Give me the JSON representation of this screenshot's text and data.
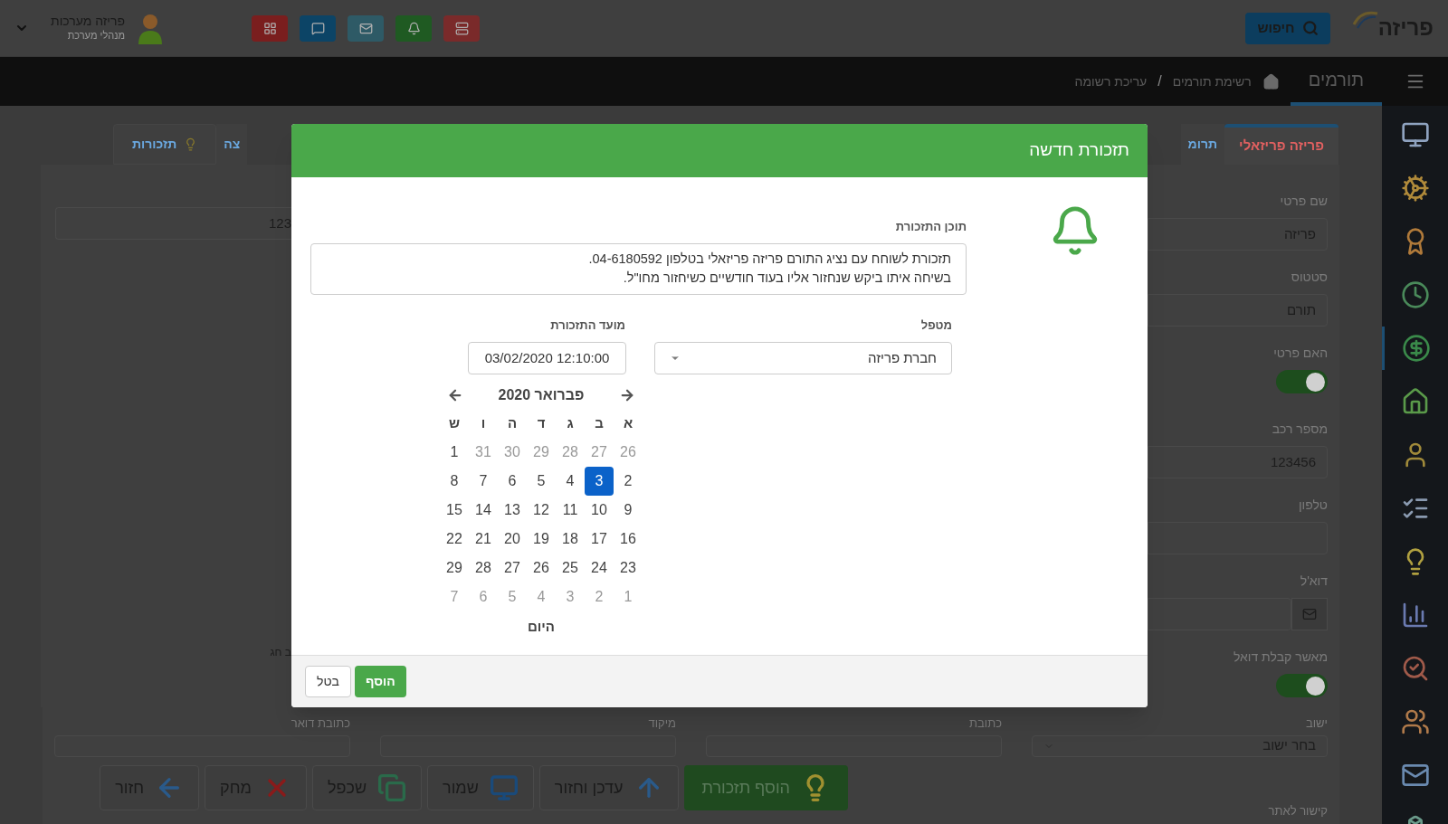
{
  "header": {
    "logo_text": "פריזה",
    "search_button": "חיפוש",
    "user": {
      "name": "פריזה מערכות",
      "role": "מנהלי מערכת"
    },
    "quick_buttons": [
      {
        "kind": "list",
        "color": "#7a2a2a"
      },
      {
        "kind": "bell",
        "color": "#1f5a22"
      },
      {
        "kind": "mail",
        "color": "#2e5a66"
      },
      {
        "kind": "chat",
        "color": "#0c4466"
      },
      {
        "kind": "grid",
        "color": "#7a1e1e"
      }
    ]
  },
  "nav": {
    "title": "תורמים",
    "breadcrumb": [
      "רשימת תורמים",
      "עריכת רשומה"
    ],
    "separator": "/"
  },
  "sidebar": {
    "items": [
      {
        "kind": "monitor",
        "selected": false
      },
      {
        "kind": "gears",
        "selected": false
      },
      {
        "kind": "award",
        "selected": false
      },
      {
        "kind": "clock",
        "selected": false
      },
      {
        "kind": "dollar",
        "selected": true
      },
      {
        "kind": "house",
        "selected": false
      },
      {
        "kind": "person",
        "selected": false
      },
      {
        "kind": "checklist",
        "selected": false
      },
      {
        "kind": "bulb",
        "selected": false
      },
      {
        "kind": "chart",
        "selected": false
      },
      {
        "kind": "chart-search",
        "selected": false
      },
      {
        "kind": "people",
        "selected": false
      },
      {
        "kind": "mail",
        "selected": false
      },
      {
        "kind": "boxes",
        "selected": false
      }
    ]
  },
  "tabs": [
    {
      "label": "פריזה פריזאלי",
      "selected": true
    },
    {
      "label": "תרומ",
      "selected": false
    },
    {
      "label": "צה",
      "selected": false
    },
    {
      "label": "תזכורות",
      "selected": false
    }
  ],
  "form_right": [
    {
      "label": "שם פרטי",
      "kind": "text",
      "value": "פריזה"
    },
    {
      "label": "סטטוס",
      "kind": "text",
      "value": "תורם"
    },
    {
      "label": "האם פרטי",
      "kind": "toggle",
      "on": true
    },
    {
      "label": "מספר רכב",
      "kind": "text",
      "value": "123456"
    },
    {
      "label": "טלפון",
      "kind": "text"
    },
    {
      "label": "דוא'ל",
      "kind": "email"
    },
    {
      "label": "מאשר קבלת דואל",
      "kind": "toggle",
      "on": true
    }
  ],
  "form_left": {
    "value": "123",
    "label": "ב חג"
  },
  "form_bottom": [
    {
      "label": "ישוב",
      "kind": "select",
      "value": "בחר ישוב"
    },
    {
      "label": "כתובת",
      "kind": "text"
    },
    {
      "label": "מיקוד",
      "kind": "text"
    },
    {
      "label": "כתובת דואר",
      "kind": "text"
    }
  ],
  "link_label": "קישור לאתר",
  "actions": [
    {
      "label": "הוסף תזכורת",
      "kind": "bulb"
    },
    {
      "label": "עדכן וחזור",
      "kind": "up"
    },
    {
      "label": "שמור",
      "kind": "save"
    },
    {
      "label": "שכפל",
      "kind": "copy"
    },
    {
      "label": "מחק",
      "kind": "delete"
    },
    {
      "label": "חזור",
      "kind": "back"
    }
  ],
  "modal": {
    "title": "תזכורת חדשה",
    "content_label": "תוכן התזכורת",
    "content": "תזכורת לשוחח עם נציג התורם פריזה פריזאלי בטלפון 04-6180592.\nבשיחה איתו ביקש שנחזור אליו בעוד חודשיים כשיחזור מחו\"ל.",
    "handler": {
      "label": "מטפל",
      "value": "חברת פריזה"
    },
    "date": {
      "label": "מועד התזכורת",
      "value": "12:10:00 03/02/2020"
    },
    "calendar": {
      "month": "פברואר 2020",
      "weekdays": [
        "א",
        "ב",
        "ג",
        "ד",
        "ה",
        "ו",
        "ש"
      ],
      "weeks": [
        [
          {
            "label": "26",
            "muted": true,
            "selected": false
          },
          {
            "label": "27",
            "muted": true,
            "selected": false
          },
          {
            "label": "28",
            "muted": true,
            "selected": false
          },
          {
            "label": "29",
            "muted": true,
            "selected": false
          },
          {
            "label": "30",
            "muted": true,
            "selected": false
          },
          {
            "label": "31",
            "muted": true,
            "selected": false
          },
          {
            "label": "1",
            "muted": false,
            "selected": false
          }
        ],
        [
          {
            "label": "2",
            "muted": false,
            "selected": false
          },
          {
            "label": "3",
            "muted": false,
            "selected": true
          },
          {
            "label": "4",
            "muted": false,
            "selected": false
          },
          {
            "label": "5",
            "muted": false,
            "selected": false
          },
          {
            "label": "6",
            "muted": false,
            "selected": false
          },
          {
            "label": "7",
            "muted": false,
            "selected": false
          },
          {
            "label": "8",
            "muted": false,
            "selected": false
          }
        ],
        [
          {
            "label": "9",
            "muted": false,
            "selected": false
          },
          {
            "label": "10",
            "muted": false,
            "selected": false
          },
          {
            "label": "11",
            "muted": false,
            "selected": false
          },
          {
            "label": "12",
            "muted": false,
            "selected": false
          },
          {
            "label": "13",
            "muted": false,
            "selected": false
          },
          {
            "label": "14",
            "muted": false,
            "selected": false
          },
          {
            "label": "15",
            "muted": false,
            "selected": false
          }
        ],
        [
          {
            "label": "16",
            "muted": false,
            "selected": false
          },
          {
            "label": "17",
            "muted": false,
            "selected": false
          },
          {
            "label": "18",
            "muted": false,
            "selected": false
          },
          {
            "label": "19",
            "muted": false,
            "selected": false
          },
          {
            "label": "20",
            "muted": false,
            "selected": false
          },
          {
            "label": "21",
            "muted": false,
            "selected": false
          },
          {
            "label": "22",
            "muted": false,
            "selected": false
          }
        ],
        [
          {
            "label": "23",
            "muted": false,
            "selected": false
          },
          {
            "label": "24",
            "muted": false,
            "selected": false
          },
          {
            "label": "25",
            "muted": false,
            "selected": false
          },
          {
            "label": "26",
            "muted": false,
            "selected": false
          },
          {
            "label": "27",
            "muted": false,
            "selected": false
          },
          {
            "label": "28",
            "muted": false,
            "selected": false
          },
          {
            "label": "29",
            "muted": false,
            "selected": false
          }
        ],
        [
          {
            "label": "1",
            "muted": true,
            "selected": false
          },
          {
            "label": "2",
            "muted": true,
            "selected": false
          },
          {
            "label": "3",
            "muted": true,
            "selected": false
          },
          {
            "label": "4",
            "muted": true,
            "selected": false
          },
          {
            "label": "5",
            "muted": true,
            "selected": false
          },
          {
            "label": "6",
            "muted": true,
            "selected": false
          },
          {
            "label": "7",
            "muted": true,
            "selected": false
          }
        ]
      ],
      "today_button": "היום"
    },
    "add_button": "הוסף",
    "cancel_button": "בטל"
  }
}
